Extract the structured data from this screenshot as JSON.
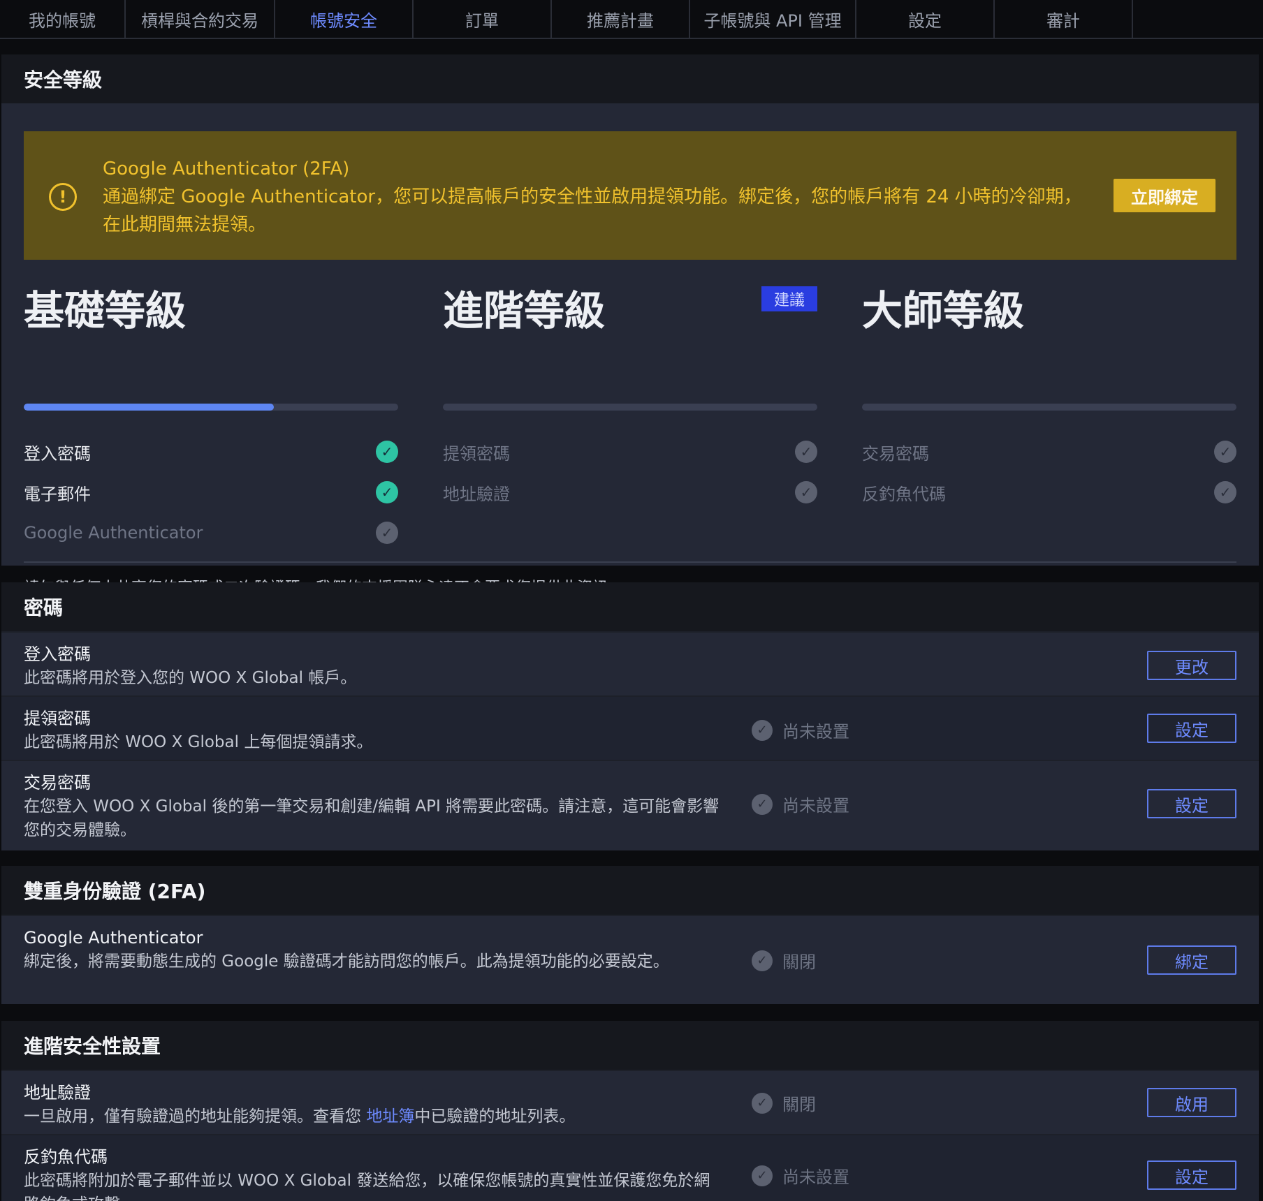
{
  "nav": {
    "tabs": [
      {
        "label": "我的帳號"
      },
      {
        "label": "槓桿與合約交易"
      },
      {
        "label": "帳號安全"
      },
      {
        "label": "訂單"
      },
      {
        "label": "推薦計畫"
      },
      {
        "label": "子帳號與 API 管理"
      },
      {
        "label": "設定"
      },
      {
        "label": "審計"
      }
    ],
    "active": "帳號安全"
  },
  "security_level": {
    "heading": "安全等級",
    "banner": {
      "title": "Google Authenticator (2FA)",
      "message": "通過綁定 Google Authenticator，您可以提高帳戶的安全性並啟用提領功能。綁定後，您的帳戶將有 24 小時的冷卻期，在此期間無法提領。",
      "button": "立即綁定"
    },
    "levels": [
      {
        "title": "基礎等級",
        "badge": "",
        "progress_fraction": 0.667,
        "items": [
          {
            "label": "登入密碼",
            "done": true
          },
          {
            "label": "電子郵件",
            "done": true
          },
          {
            "label": "Google Authenticator",
            "done": false
          }
        ]
      },
      {
        "title": "進階等級",
        "badge": "建議",
        "progress_fraction": 0,
        "items": [
          {
            "label": "提領密碼",
            "done": false
          },
          {
            "label": "地址驗證",
            "done": false
          }
        ]
      },
      {
        "title": "大師等級",
        "badge": "",
        "progress_fraction": 0,
        "items": [
          {
            "label": "交易密碼",
            "done": false
          },
          {
            "label": "反釣魚代碼",
            "done": false
          }
        ]
      }
    ],
    "warning": "請勿與任何人共享您的密碼或二次驗證碼。我們的支援團隊永遠不會要求您提供此資訊。"
  },
  "password": {
    "heading": "密碼",
    "rows": [
      {
        "title": "登入密碼",
        "desc": "此密碼將用於登入您的 WOO X Global 帳戶。",
        "status": "",
        "button": "更改"
      },
      {
        "title": "提領密碼",
        "desc": "此密碼將用於 WOO X Global 上每個提領請求。",
        "status": "尚未設置",
        "button": "設定"
      },
      {
        "title": "交易密碼",
        "desc": "在您登入 WOO X Global 後的第一筆交易和創建/編輯 API 將需要此密碼。請注意，這可能會影響您的交易體驗。",
        "status": "尚未設置",
        "button": "設定"
      }
    ]
  },
  "twofa": {
    "heading": "雙重身份驗證 (2FA)",
    "rows": [
      {
        "title": "Google Authenticator",
        "desc": "綁定後，將需要動態生成的 Google 驗證碼才能訪問您的帳戶。此為提領功能的必要設定。",
        "status": "關閉",
        "button": "綁定"
      }
    ]
  },
  "advanced": {
    "heading": "進階安全性設置",
    "rows": [
      {
        "title": "地址驗證",
        "desc_before": "一旦啟用，僅有驗證過的地址能夠提領。查看您 ",
        "desc_link": "地址簿",
        "desc_after": "中已驗證的地址列表。",
        "status": "關閉",
        "button": "啟用"
      },
      {
        "title": "反釣魚代碼",
        "desc": "此密碼將附加於電子郵件並以 WOO X Global 發送給您，以確保您帳號的真實性並保護您免於網路釣魚式攻擊。",
        "status": "尚未設置",
        "button": "設定"
      }
    ]
  },
  "icons": {
    "warning": "exclamation-circle-icon",
    "check": "check-circle-icon"
  },
  "colors": {
    "accent": "#6e8bff",
    "banner_bg": "#5f5218",
    "banner_text": "#f1c22d",
    "check_on": "#2ec4a4",
    "badge_bg": "#2a3de0"
  }
}
